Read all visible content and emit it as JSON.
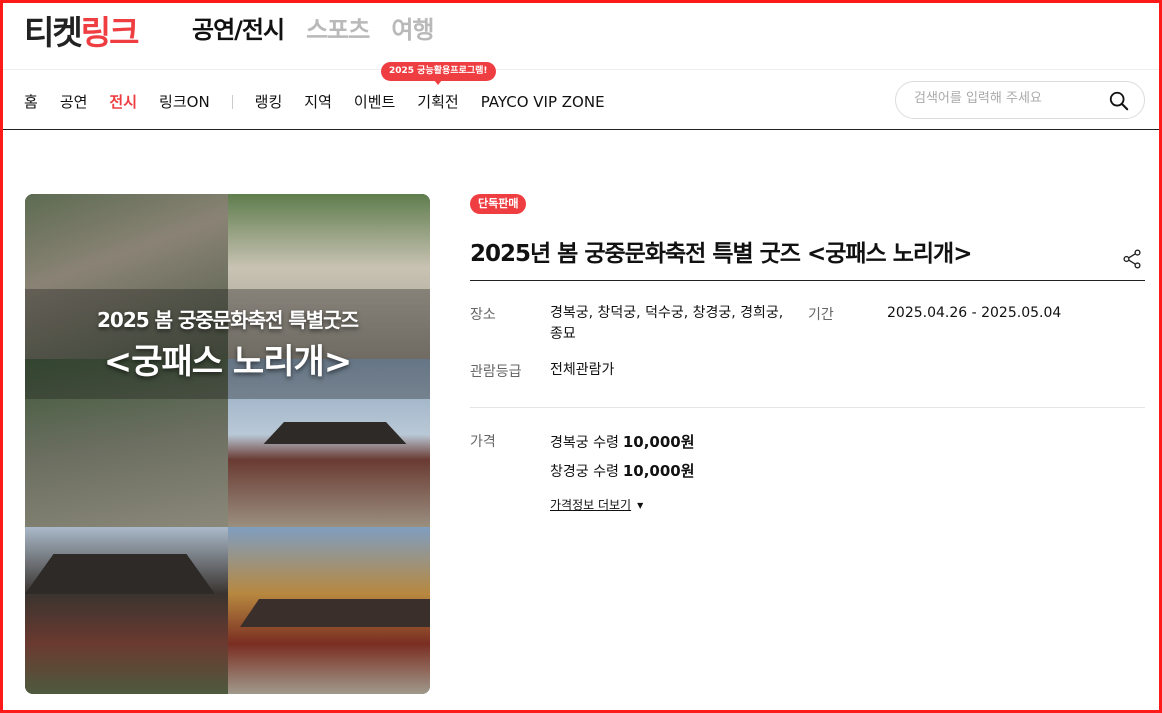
{
  "header": {
    "logo_part1": "티켓",
    "logo_part2": "링크",
    "category_tabs": [
      {
        "label": "공연/전시",
        "active": true
      },
      {
        "label": "스포츠",
        "active": false
      },
      {
        "label": "여행",
        "active": false
      }
    ]
  },
  "nav": {
    "items": [
      {
        "label": "홈"
      },
      {
        "label": "공연"
      },
      {
        "label": "전시",
        "active": true
      },
      {
        "label": "링크ON"
      },
      {
        "label": "랭킹"
      },
      {
        "label": "지역"
      },
      {
        "label": "이벤트"
      },
      {
        "label": "기획전"
      },
      {
        "label": "PAYCO VIP ZONE"
      }
    ],
    "promo_bubble": "2025 궁능활용프로그램!",
    "search_placeholder": "검색어를 입력해 주세요"
  },
  "poster": {
    "line1": "2025 봄 궁중문화축전 특별굿즈",
    "line2": "<궁패스 노리개>"
  },
  "product": {
    "badge": "단독판매",
    "title": "2025년 봄 궁중문화축전 특별 굿즈 <궁패스 노리개>",
    "venue_label": "장소",
    "venue_value": "경복궁, 창덕궁, 덕수궁, 창경궁, 경희궁, 종묘",
    "period_label": "기간",
    "period_value": "2025.04.26 - 2025.05.04",
    "rating_label": "관람등급",
    "rating_value": "전체관람가",
    "price_label": "가격",
    "prices": [
      {
        "name": "경복궁 수령",
        "amount": "10,000원"
      },
      {
        "name": "창경궁 수령",
        "amount": "10,000원"
      }
    ],
    "more_prices": "가격정보 더보기"
  },
  "colors": {
    "accent": "#ef3e42",
    "frame": "#ff1a1a"
  }
}
